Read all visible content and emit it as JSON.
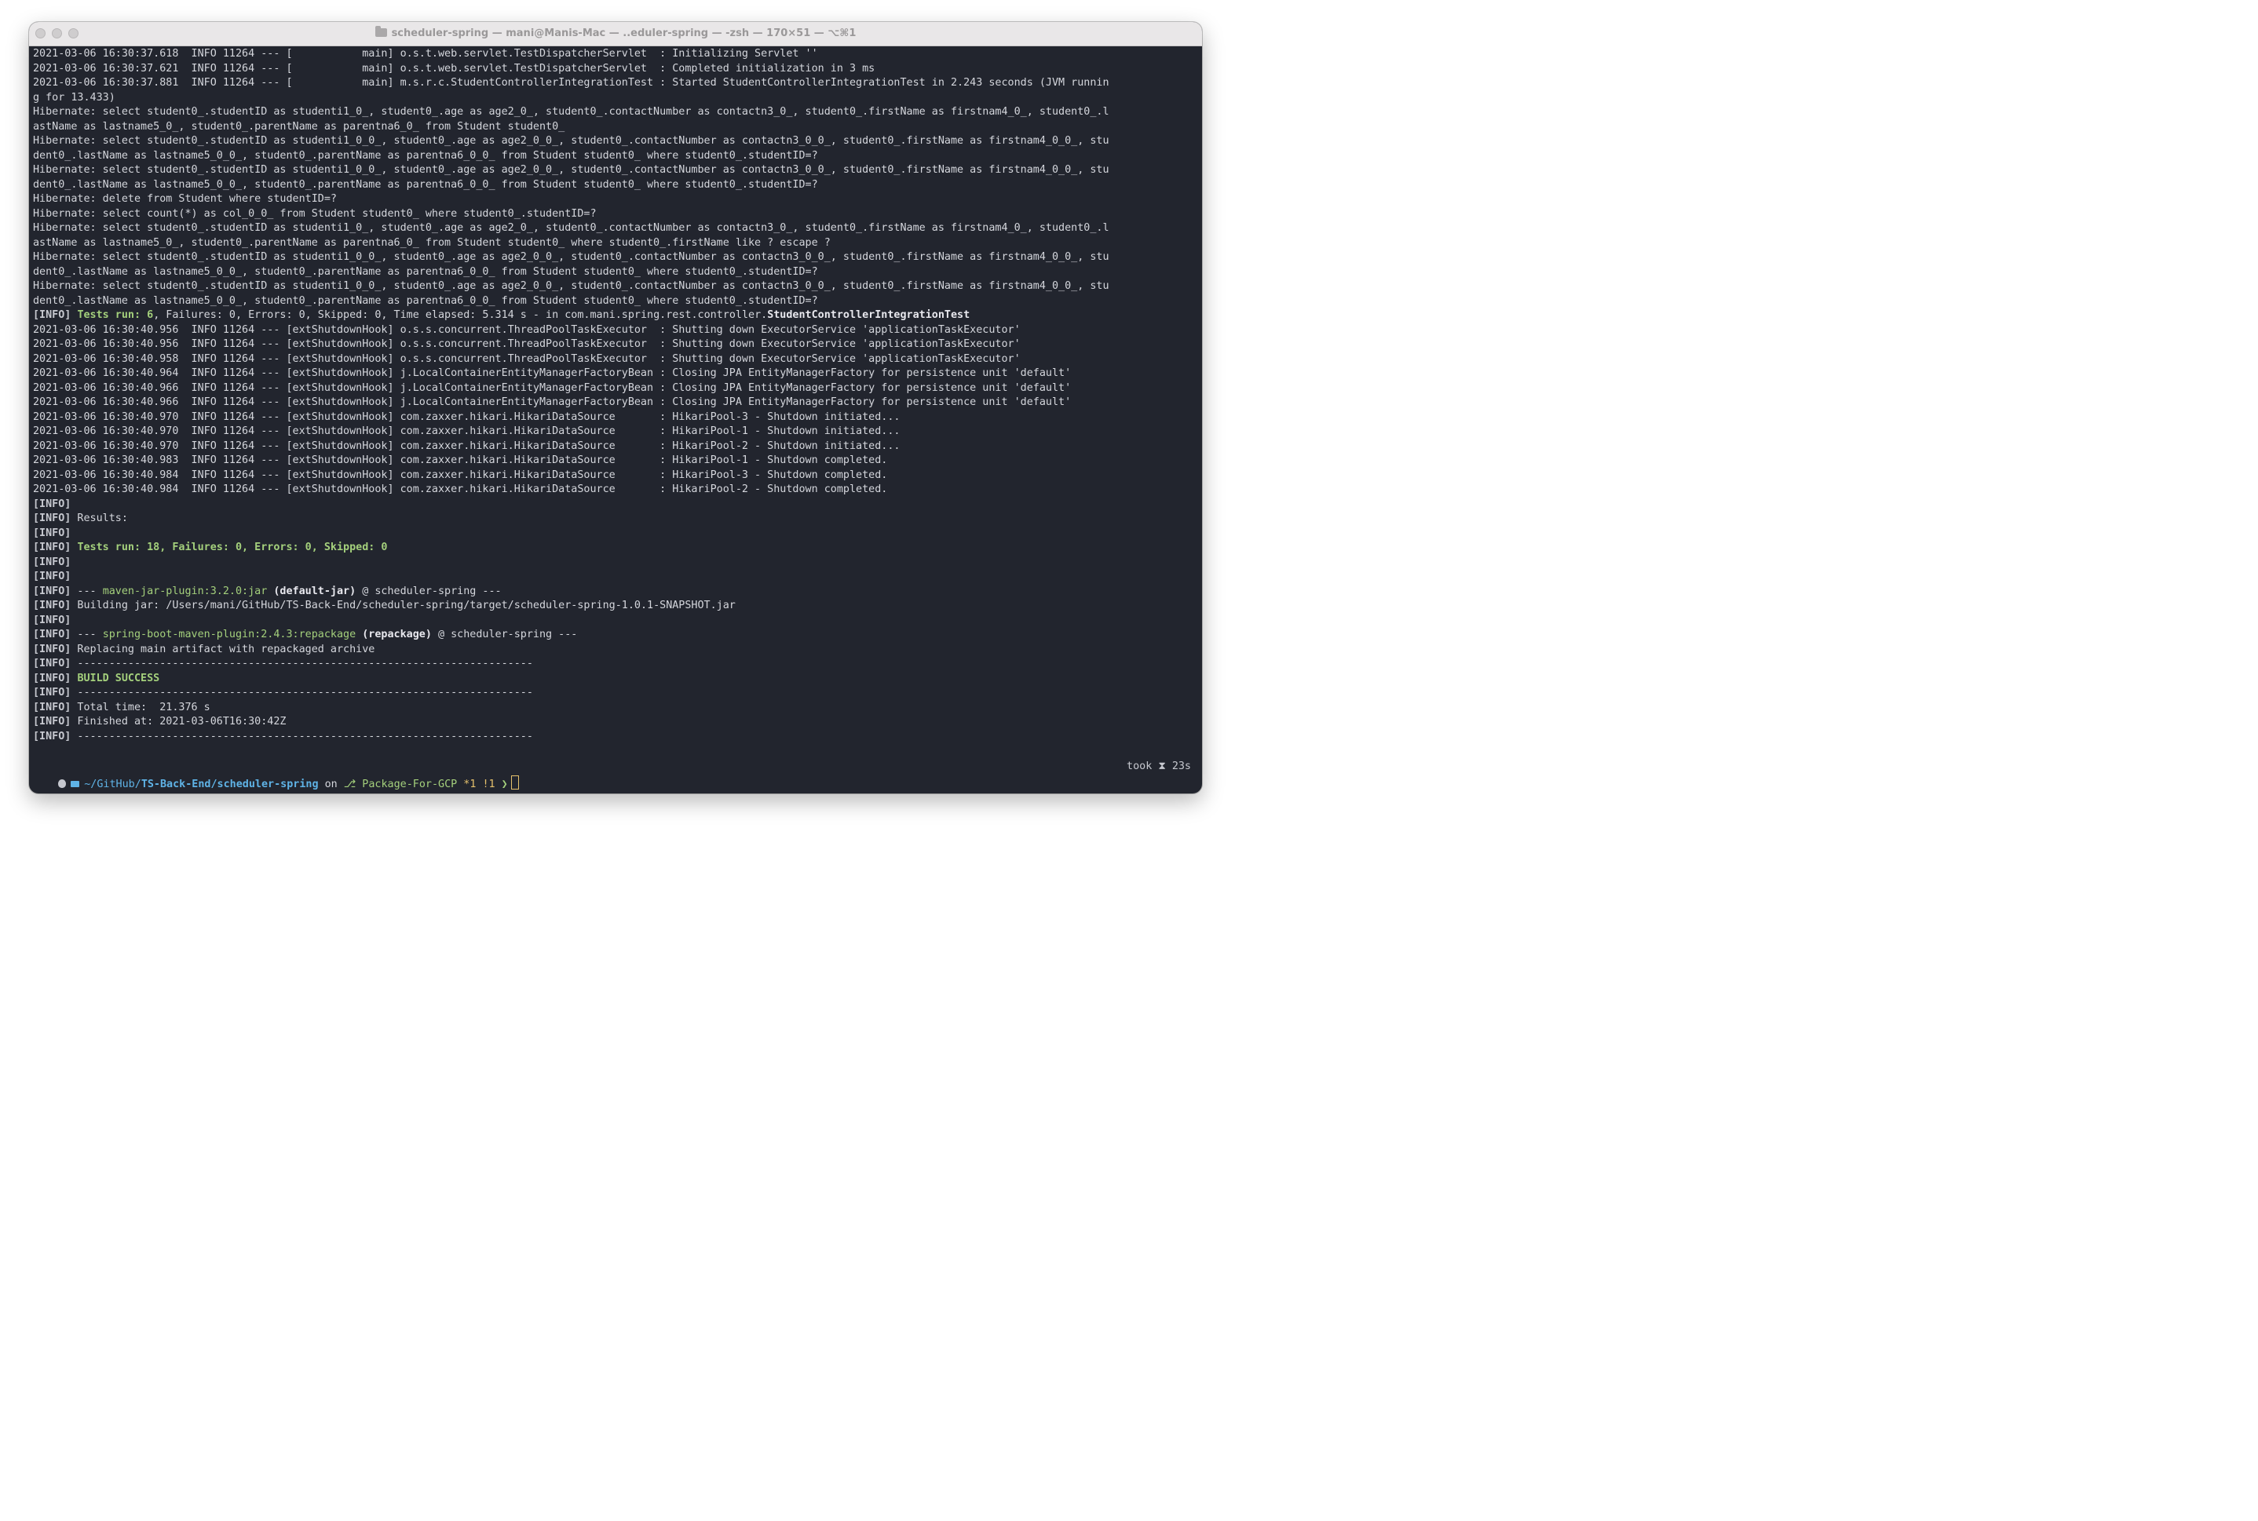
{
  "window": {
    "title": "scheduler-spring — mani@Manis-Mac — ..eduler-spring — -zsh — 170×51 — ⌥⌘1"
  },
  "terminal": {
    "lines": [
      [
        {
          "t": "2021-03-06 16:30:37.618  INFO 11264 --- [           main] o.s.t.web.servlet.TestDispatcherServlet  : Initializing Servlet ''"
        }
      ],
      [
        {
          "t": "2021-03-06 16:30:37.621  INFO 11264 --- [           main] o.s.t.web.servlet.TestDispatcherServlet  : Completed initialization in 3 ms"
        }
      ],
      [
        {
          "t": "2021-03-06 16:30:37.881  INFO 11264 --- [           main] m.s.r.c.StudentControllerIntegrationTest : Started StudentControllerIntegrationTest in 2.243 seconds (JVM runnin"
        }
      ],
      [
        {
          "t": "g for 13.433)"
        }
      ],
      [
        {
          "t": "Hibernate: select student0_.studentID as studenti1_0_, student0_.age as age2_0_, student0_.contactNumber as contactn3_0_, student0_.firstName as firstnam4_0_, student0_.l"
        }
      ],
      [
        {
          "t": "astName as lastname5_0_, student0_.parentName as parentna6_0_ from Student student0_"
        }
      ],
      [
        {
          "t": "Hibernate: select student0_.studentID as studenti1_0_0_, student0_.age as age2_0_0_, student0_.contactNumber as contactn3_0_0_, student0_.firstName as firstnam4_0_0_, stu"
        }
      ],
      [
        {
          "t": "dent0_.lastName as lastname5_0_0_, student0_.parentName as parentna6_0_0_ from Student student0_ where student0_.studentID=?"
        }
      ],
      [
        {
          "t": "Hibernate: select student0_.studentID as studenti1_0_0_, student0_.age as age2_0_0_, student0_.contactNumber as contactn3_0_0_, student0_.firstName as firstnam4_0_0_, stu"
        }
      ],
      [
        {
          "t": "dent0_.lastName as lastname5_0_0_, student0_.parentName as parentna6_0_0_ from Student student0_ where student0_.studentID=?"
        }
      ],
      [
        {
          "t": "Hibernate: delete from Student where studentID=?"
        }
      ],
      [
        {
          "t": "Hibernate: select count(*) as col_0_0_ from Student student0_ where student0_.studentID=?"
        }
      ],
      [
        {
          "t": "Hibernate: select student0_.studentID as studenti1_0_, student0_.age as age2_0_, student0_.contactNumber as contactn3_0_, student0_.firstName as firstnam4_0_, student0_.l"
        }
      ],
      [
        {
          "t": "astName as lastname5_0_, student0_.parentName as parentna6_0_ from Student student0_ where student0_.firstName like ? escape ?"
        }
      ],
      [
        {
          "t": "Hibernate: select student0_.studentID as studenti1_0_0_, student0_.age as age2_0_0_, student0_.contactNumber as contactn3_0_0_, student0_.firstName as firstnam4_0_0_, stu"
        }
      ],
      [
        {
          "t": "dent0_.lastName as lastname5_0_0_, student0_.parentName as parentna6_0_0_ from Student student0_ where student0_.studentID=?"
        }
      ],
      [
        {
          "t": "Hibernate: select student0_.studentID as studenti1_0_0_, student0_.age as age2_0_0_, student0_.contactNumber as contactn3_0_0_, student0_.firstName as firstnam4_0_0_, stu"
        }
      ],
      [
        {
          "t": "dent0_.lastName as lastname5_0_0_, student0_.parentName as parentna6_0_0_ from Student student0_ where student0_.studentID=?"
        }
      ],
      [
        {
          "t": "[INFO]",
          "c": "info"
        },
        {
          "t": " "
        },
        {
          "t": "Tests run: 6",
          "c": "gb"
        },
        {
          "t": ", Failures: 0, Errors: 0, Skipped: 0, Time elapsed: 5.314 s - in com.mani.spring.rest.controller."
        },
        {
          "t": "StudentControllerIntegrationTest",
          "c": "b"
        }
      ],
      [
        {
          "t": "2021-03-06 16:30:40.956  INFO 11264 --- [extShutdownHook] o.s.s.concurrent.ThreadPoolTaskExecutor  : Shutting down ExecutorService 'applicationTaskExecutor'"
        }
      ],
      [
        {
          "t": "2021-03-06 16:30:40.956  INFO 11264 --- [extShutdownHook] o.s.s.concurrent.ThreadPoolTaskExecutor  : Shutting down ExecutorService 'applicationTaskExecutor'"
        }
      ],
      [
        {
          "t": "2021-03-06 16:30:40.958  INFO 11264 --- [extShutdownHook] o.s.s.concurrent.ThreadPoolTaskExecutor  : Shutting down ExecutorService 'applicationTaskExecutor'"
        }
      ],
      [
        {
          "t": "2021-03-06 16:30:40.964  INFO 11264 --- [extShutdownHook] j.LocalContainerEntityManagerFactoryBean : Closing JPA EntityManagerFactory for persistence unit 'default'"
        }
      ],
      [
        {
          "t": "2021-03-06 16:30:40.966  INFO 11264 --- [extShutdownHook] j.LocalContainerEntityManagerFactoryBean : Closing JPA EntityManagerFactory for persistence unit 'default'"
        }
      ],
      [
        {
          "t": "2021-03-06 16:30:40.966  INFO 11264 --- [extShutdownHook] j.LocalContainerEntityManagerFactoryBean : Closing JPA EntityManagerFactory for persistence unit 'default'"
        }
      ],
      [
        {
          "t": "2021-03-06 16:30:40.970  INFO 11264 --- [extShutdownHook] com.zaxxer.hikari.HikariDataSource       : HikariPool-3 - Shutdown initiated..."
        }
      ],
      [
        {
          "t": "2021-03-06 16:30:40.970  INFO 11264 --- [extShutdownHook] com.zaxxer.hikari.HikariDataSource       : HikariPool-1 - Shutdown initiated..."
        }
      ],
      [
        {
          "t": "2021-03-06 16:30:40.970  INFO 11264 --- [extShutdownHook] com.zaxxer.hikari.HikariDataSource       : HikariPool-2 - Shutdown initiated..."
        }
      ],
      [
        {
          "t": "2021-03-06 16:30:40.983  INFO 11264 --- [extShutdownHook] com.zaxxer.hikari.HikariDataSource       : HikariPool-1 - Shutdown completed."
        }
      ],
      [
        {
          "t": "2021-03-06 16:30:40.984  INFO 11264 --- [extShutdownHook] com.zaxxer.hikari.HikariDataSource       : HikariPool-3 - Shutdown completed."
        }
      ],
      [
        {
          "t": "2021-03-06 16:30:40.984  INFO 11264 --- [extShutdownHook] com.zaxxer.hikari.HikariDataSource       : HikariPool-2 - Shutdown completed."
        }
      ],
      [
        {
          "t": "[INFO]",
          "c": "info"
        }
      ],
      [
        {
          "t": "[INFO]",
          "c": "info"
        },
        {
          "t": " Results:"
        }
      ],
      [
        {
          "t": "[INFO]",
          "c": "info"
        }
      ],
      [
        {
          "t": "[INFO]",
          "c": "info"
        },
        {
          "t": " "
        },
        {
          "t": "Tests run: 18, Failures: 0, Errors: 0, Skipped: 0",
          "c": "gb"
        }
      ],
      [
        {
          "t": "[INFO]",
          "c": "info"
        }
      ],
      [
        {
          "t": "[INFO]",
          "c": "info"
        }
      ],
      [
        {
          "t": "[INFO]",
          "c": "info"
        },
        {
          "t": " --- "
        },
        {
          "t": "maven-jar-plugin:3.2.0:jar",
          "c": "g"
        },
        {
          "t": " "
        },
        {
          "t": "(default-jar)",
          "c": "b"
        },
        {
          "t": " @ scheduler-spring ---"
        }
      ],
      [
        {
          "t": "[INFO]",
          "c": "info"
        },
        {
          "t": " Building jar: /Users/mani/GitHub/TS-Back-End/scheduler-spring/target/scheduler-spring-1.0.1-SNAPSHOT.jar"
        }
      ],
      [
        {
          "t": "[INFO]",
          "c": "info"
        }
      ],
      [
        {
          "t": "[INFO]",
          "c": "info"
        },
        {
          "t": " --- "
        },
        {
          "t": "spring-boot-maven-plugin:2.4.3:repackage",
          "c": "g"
        },
        {
          "t": " "
        },
        {
          "t": "(repackage)",
          "c": "b"
        },
        {
          "t": " @ scheduler-spring ---"
        }
      ],
      [
        {
          "t": "[INFO]",
          "c": "info"
        },
        {
          "t": " Replacing main artifact with repackaged archive"
        }
      ],
      [
        {
          "t": "[INFO]",
          "c": "info"
        },
        {
          "t": " ------------------------------------------------------------------------"
        }
      ],
      [
        {
          "t": "[INFO]",
          "c": "info"
        },
        {
          "t": " "
        },
        {
          "t": "BUILD SUCCESS",
          "c": "gb"
        }
      ],
      [
        {
          "t": "[INFO]",
          "c": "info"
        },
        {
          "t": " ------------------------------------------------------------------------"
        }
      ],
      [
        {
          "t": "[INFO]",
          "c": "info"
        },
        {
          "t": " Total time:  21.376 s"
        }
      ],
      [
        {
          "t": "[INFO]",
          "c": "info"
        },
        {
          "t": " Finished at: 2021-03-06T16:30:42Z"
        }
      ],
      [
        {
          "t": "[INFO]",
          "c": "info"
        },
        {
          "t": " ------------------------------------------------------------------------"
        }
      ]
    ]
  },
  "prompt": {
    "apple_icon": "apple-icon",
    "folder_icon": "folder-icon",
    "path_prefix": "~/GitHub/",
    "path_bold": "TS-Back-End/scheduler-spring",
    "on_text": "on",
    "git_icon": "git-branch-icon",
    "branch": "Package-For-GCP",
    "dirty": "*1 !1",
    "arrow": "❯",
    "took_label": "took",
    "hourglass": "⧗",
    "took_value": "23s"
  },
  "colors": {
    "background": "#22252e",
    "text": "#d4d6dc",
    "green": "#a4d07c",
    "blue": "#5fb3e6",
    "yellow": "#e5c16c"
  }
}
